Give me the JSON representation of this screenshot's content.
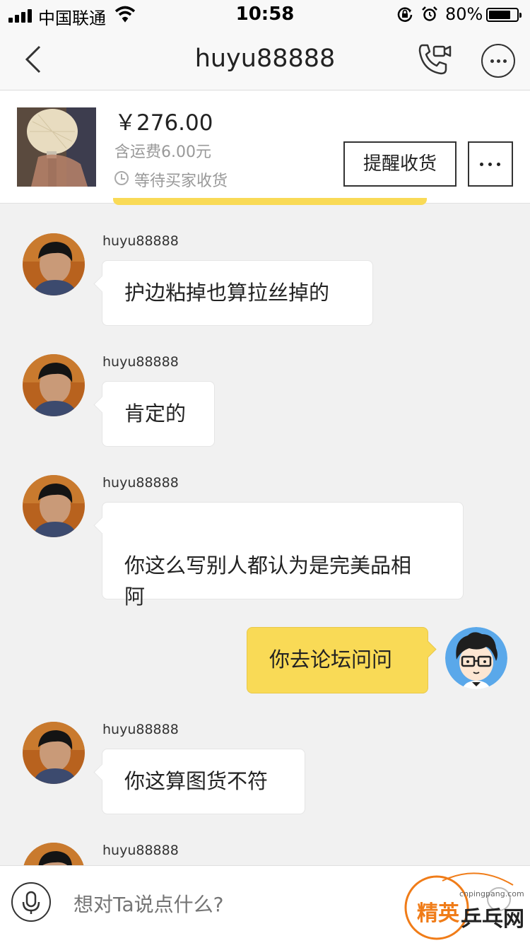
{
  "status_bar": {
    "carrier": "中国联通",
    "time": "10:58",
    "battery_text": "80%",
    "battery_level": 0.8
  },
  "nav": {
    "title": "huyu88888",
    "back_icon": "chevron-left-icon",
    "call_icon": "phone-video-icon",
    "more_icon": "more-icon"
  },
  "product": {
    "price": "￥276.00",
    "shipping": "含运费6.00元",
    "status": "等待买家收货",
    "remind_label": "提醒收货"
  },
  "messages": [
    {
      "sender": "huyu88888",
      "text": "护边粘掉也算拉丝掉的",
      "side": "left"
    },
    {
      "sender": "huyu88888",
      "text": "肯定的",
      "side": "left"
    },
    {
      "sender": "huyu88888",
      "text": "你这么写别人都认为是完美品相\n阿",
      "side": "left"
    },
    {
      "sender": "",
      "text": "你去论坛问问",
      "side": "right"
    },
    {
      "sender": "huyu88888",
      "text": "你这算图货不符",
      "side": "left"
    },
    {
      "sender": "huyu88888",
      "text": "",
      "side": "left"
    }
  ],
  "input": {
    "placeholder": "想对Ta说点什么?"
  },
  "watermark": {
    "brand_top": "精英",
    "brand_bottom": "乒乓网",
    "url": "cnpingpang.com"
  },
  "colors": {
    "accent_yellow": "#f9da56",
    "background": "#f1f1f1",
    "watermark_orange": "#f07c18"
  }
}
